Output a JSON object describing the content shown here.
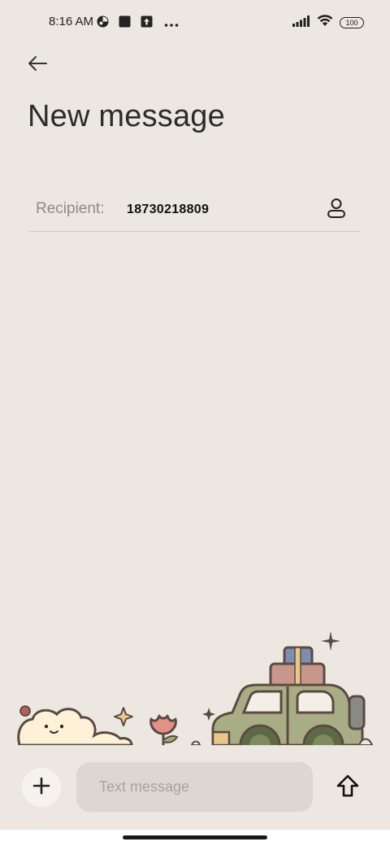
{
  "status_bar": {
    "time": "8:16 AM",
    "battery": "100",
    "icons": [
      "app-notification-icon",
      "square-notification-icon",
      "upload-notification-icon",
      "more-dots-icon",
      "signal-icon",
      "wifi-icon",
      "battery-icon"
    ]
  },
  "header": {
    "back_icon": "arrow-left-icon",
    "title": "New message"
  },
  "recipient": {
    "label": "Recipient:",
    "value": "18730218809",
    "contact_icon": "person-icon"
  },
  "compose": {
    "attach_icon": "plus-icon",
    "placeholder": "Text message",
    "value": "",
    "send_icon": "send-arrow-up-icon"
  },
  "colors": {
    "background": "#ece7e1",
    "input_background": "#dcd7d2",
    "text_primary": "#1f1f1f",
    "text_secondary": "#8e8a86",
    "divider": "#cfcac4"
  }
}
